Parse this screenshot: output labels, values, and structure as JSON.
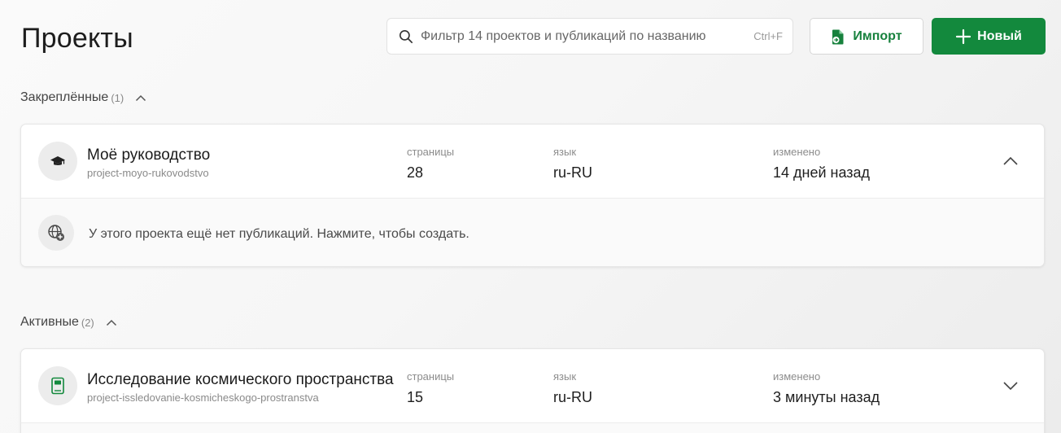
{
  "header": {
    "title": "Проекты",
    "search": {
      "placeholder": "Фильтр 14 проектов и публикаций по названию",
      "shortcut": "Ctrl+F"
    },
    "import_label": "Импорт",
    "new_label": "Новый"
  },
  "colors": {
    "accent": "#13893d",
    "accent_text": "#17813d"
  },
  "sections": {
    "pinned": {
      "title": "Закреплённые",
      "count": "(1)",
      "projects": [
        {
          "name": "Моё руководство",
          "slug": "project-moyo-rukovodstvo",
          "icon": "graduation-cap-icon",
          "pages_label": "страницы",
          "pages": "28",
          "lang_label": "язык",
          "lang": "ru-RU",
          "modified_label": "изменено",
          "modified": "14 дней назад",
          "expanded": true,
          "empty_publications": "У этого проекта ещё нет публикаций. Нажмите, чтобы создать."
        }
      ]
    },
    "active": {
      "title": "Активные",
      "count": "(2)",
      "projects": [
        {
          "name": "Исследование космического пространства",
          "slug": "project-issledovanie-kosmicheskogo-prostranstva",
          "icon": "book-icon",
          "pages_label": "страницы",
          "pages": "15",
          "lang_label": "язык",
          "lang": "ru-RU",
          "modified_label": "изменено",
          "modified": "3 минуты назад",
          "expanded": false
        }
      ]
    }
  }
}
